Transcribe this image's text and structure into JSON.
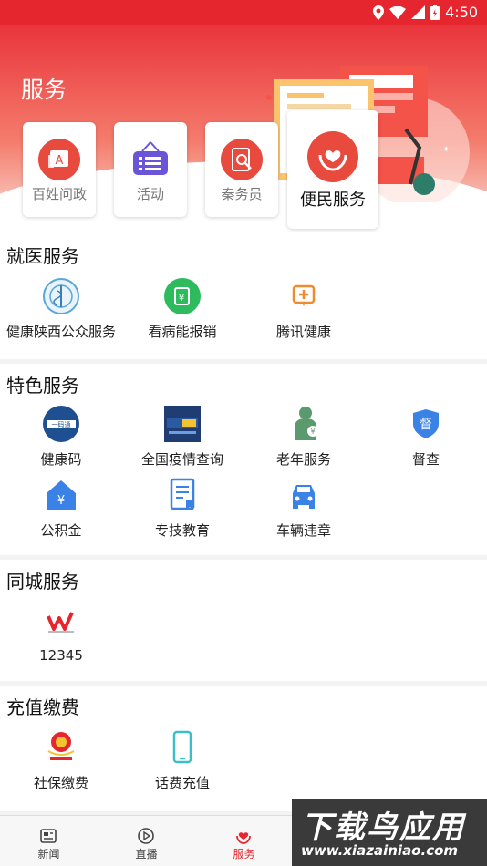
{
  "status": {
    "time": "4:50"
  },
  "page_title": "服务",
  "quick_actions": [
    {
      "label": "百姓问政",
      "icon": "complaint-icon"
    },
    {
      "label": "活动",
      "icon": "activity-icon"
    },
    {
      "label": "秦务员",
      "icon": "search-doc-icon"
    },
    {
      "label": "便民服务",
      "icon": "heart-hands-icon"
    }
  ],
  "sections": {
    "medical": {
      "title": "就医服务",
      "items": [
        {
          "label": "健康陕西公众服务",
          "icon": "health-shaanxi-logo-icon"
        },
        {
          "label": "看病能报销",
          "icon": "reimburse-icon"
        },
        {
          "label": "腾讯健康",
          "icon": "tencent-health-icon"
        }
      ]
    },
    "featured": {
      "title": "特色服务",
      "items": [
        {
          "label": "健康码",
          "icon": "health-code-icon"
        },
        {
          "label": "全国疫情查询",
          "icon": "epidemic-query-icon"
        },
        {
          "label": "老年服务",
          "icon": "elderly-service-icon"
        },
        {
          "label": "督查",
          "icon": "supervision-icon"
        },
        {
          "label": "公积金",
          "icon": "housing-fund-icon"
        },
        {
          "label": "专技教育",
          "icon": "education-icon"
        },
        {
          "label": "车辆违章",
          "icon": "car-violation-icon"
        }
      ]
    },
    "city": {
      "title": "同城服务",
      "items": [
        {
          "label": "12345",
          "icon": "hotline-12345-logo-icon"
        }
      ]
    },
    "recharge": {
      "title": "充值缴费",
      "items": [
        {
          "label": "社保缴费",
          "icon": "social-insurance-emblem-icon"
        },
        {
          "label": "话费充值",
          "icon": "phone-icon"
        }
      ]
    }
  },
  "tabbar": [
    {
      "label": "新闻",
      "icon": "news-icon",
      "active": false
    },
    {
      "label": "直播",
      "icon": "live-play-icon",
      "active": false
    },
    {
      "label": "服务",
      "icon": "service-heart-icon",
      "active": true
    }
  ],
  "watermark": {
    "title": "下载鸟应用",
    "url": "www.xiazainiao.com"
  },
  "colors": {
    "brand_red": "#e6262e",
    "accent_orange": "#f08a2c",
    "green": "#2dbb5d",
    "blue": "#3b82e6",
    "teal": "#3bbfc4"
  }
}
